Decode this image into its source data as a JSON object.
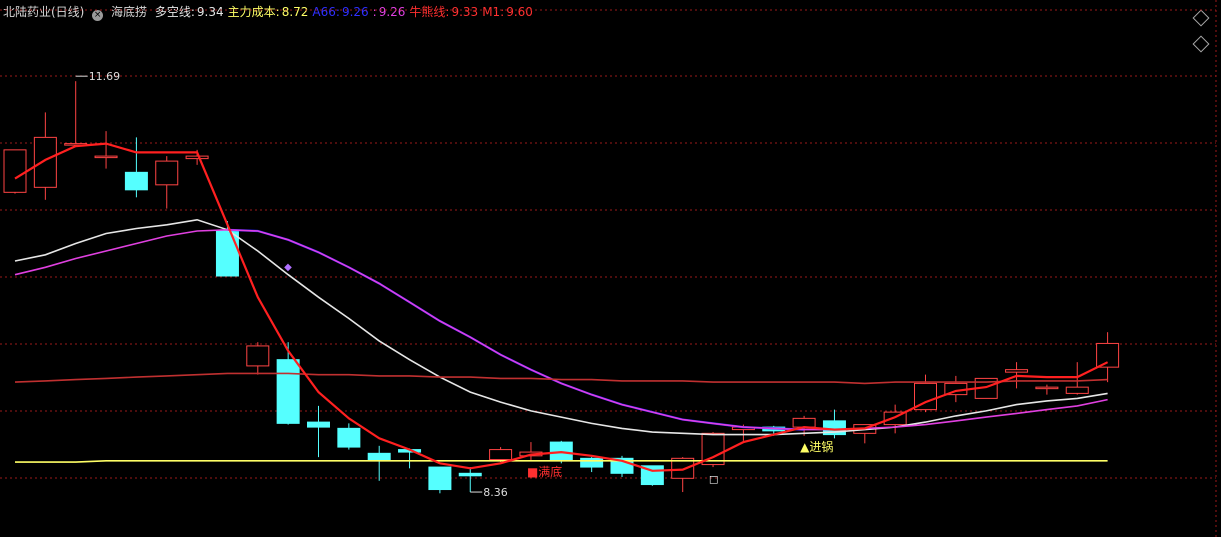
{
  "header": {
    "stock": "北陆药业(日线)",
    "indicator": "海底捞",
    "items": [
      {
        "label": "多空线:",
        "value": "9.34",
        "color": "#e6e6e6"
      },
      {
        "label": "主力成本:",
        "value": "8.72",
        "color": "#ffff66"
      },
      {
        "label": "A66:",
        "value": "9.26",
        "color": "#3030ff"
      },
      {
        "label": ":",
        "value": "9.26",
        "color": "#e040e0"
      },
      {
        "label": "牛熊线:",
        "value": "9.33",
        "color": "#ff3030"
      },
      {
        "label": "M1:",
        "value": "9.60",
        "color": "#ff3030"
      }
    ]
  },
  "chart_data": {
    "type": "candlestick",
    "ylim": [
      8.0,
      12.3
    ],
    "candles": [
      {
        "o": 10.76,
        "h": 11.1,
        "l": 10.75,
        "c": 11.1
      },
      {
        "o": 10.8,
        "h": 11.4,
        "l": 10.7,
        "c": 11.2
      },
      {
        "o": 11.15,
        "h": 11.65,
        "l": 11.14,
        "c": 11.15
      },
      {
        "o": 11.05,
        "h": 11.25,
        "l": 10.95,
        "c": 11.05
      },
      {
        "o": 10.92,
        "h": 11.2,
        "l": 10.72,
        "c": 10.78
      },
      {
        "o": 10.82,
        "h": 11.05,
        "l": 10.63,
        "c": 11.01
      },
      {
        "o": 11.03,
        "h": 11.1,
        "l": 10.98,
        "c": 11.05
      },
      {
        "o": 10.45,
        "h": 10.53,
        "l": 10.09,
        "c": 10.09
      },
      {
        "o": 9.37,
        "h": 9.56,
        "l": 9.3,
        "c": 9.53
      },
      {
        "o": 9.42,
        "h": 9.56,
        "l": 8.9,
        "c": 8.91
      },
      {
        "o": 8.92,
        "h": 9.05,
        "l": 8.64,
        "c": 8.88
      },
      {
        "o": 8.87,
        "h": 8.91,
        "l": 8.7,
        "c": 8.72
      },
      {
        "o": 8.67,
        "h": 8.73,
        "l": 8.45,
        "c": 8.62
      },
      {
        "o": 8.7,
        "h": 8.71,
        "l": 8.55,
        "c": 8.68
      },
      {
        "o": 8.56,
        "h": 8.56,
        "l": 8.35,
        "c": 8.38
      },
      {
        "o": 8.51,
        "h": 8.56,
        "l": 8.36,
        "c": 8.49
      },
      {
        "o": 8.62,
        "h": 8.72,
        "l": 8.6,
        "c": 8.7
      },
      {
        "o": 8.65,
        "h": 8.76,
        "l": 8.61,
        "c": 8.68
      },
      {
        "o": 8.76,
        "h": 8.77,
        "l": 8.59,
        "c": 8.61
      },
      {
        "o": 8.63,
        "h": 8.64,
        "l": 8.52,
        "c": 8.56
      },
      {
        "o": 8.63,
        "h": 8.65,
        "l": 8.48,
        "c": 8.51
      },
      {
        "o": 8.57,
        "h": 8.57,
        "l": 8.41,
        "c": 8.42
      },
      {
        "o": 8.47,
        "h": 8.64,
        "l": 8.36,
        "c": 8.63
      },
      {
        "o": 8.58,
        "h": 8.84,
        "l": 8.56,
        "c": 8.83
      },
      {
        "o": 8.86,
        "h": 8.9,
        "l": 8.77,
        "c": 8.88
      },
      {
        "o": 8.88,
        "h": 8.89,
        "l": 8.81,
        "c": 8.85
      },
      {
        "o": 8.88,
        "h": 8.97,
        "l": 8.81,
        "c": 8.95
      },
      {
        "o": 8.93,
        "h": 9.02,
        "l": 8.79,
        "c": 8.82
      },
      {
        "o": 8.83,
        "h": 8.89,
        "l": 8.75,
        "c": 8.9
      },
      {
        "o": 8.9,
        "h": 9.06,
        "l": 8.83,
        "c": 9.0
      },
      {
        "o": 9.02,
        "h": 9.3,
        "l": 9.0,
        "c": 9.23
      },
      {
        "o": 9.14,
        "h": 9.29,
        "l": 9.08,
        "c": 9.23
      },
      {
        "o": 9.11,
        "h": 9.26,
        "l": 9.12,
        "c": 9.27
      },
      {
        "o": 9.32,
        "h": 9.4,
        "l": 9.19,
        "c": 9.34
      },
      {
        "o": 9.19,
        "h": 9.22,
        "l": 9.14,
        "c": 9.2
      },
      {
        "o": 9.15,
        "h": 9.4,
        "l": 9.14,
        "c": 9.2
      },
      {
        "o": 9.36,
        "h": 9.64,
        "l": 9.24,
        "c": 9.55
      }
    ],
    "series": [
      {
        "name": "多空线",
        "color": "#e6e6e6",
        "values": [
          10.21,
          10.26,
          10.35,
          10.43,
          10.47,
          10.5,
          10.54,
          10.46,
          10.29,
          10.1,
          9.92,
          9.75,
          9.57,
          9.42,
          9.28,
          9.16,
          9.08,
          9.01,
          8.96,
          8.91,
          8.87,
          8.84,
          8.83,
          8.82,
          8.82,
          8.82,
          8.83,
          8.84,
          8.86,
          8.88,
          8.92,
          8.97,
          9.01,
          9.06,
          9.09,
          9.11,
          9.15
        ]
      },
      {
        "name": "主力成本",
        "color": "#ffff66",
        "values": [
          8.6,
          8.6,
          8.6,
          8.61,
          8.61,
          8.61,
          8.61,
          8.61,
          8.61,
          8.61,
          8.61,
          8.61,
          8.61,
          8.61,
          8.61,
          8.61,
          8.61,
          8.61,
          8.61,
          8.61,
          8.61,
          8.61,
          8.61,
          8.61,
          8.61,
          8.61,
          8.61,
          8.61,
          8.61,
          8.61,
          8.61,
          8.61,
          8.61,
          8.61,
          8.61,
          8.61,
          8.61
        ]
      },
      {
        "name": "A66",
        "color": "#2020ff",
        "values": [
          null,
          null,
          null,
          null,
          null,
          null,
          null,
          10.46,
          10.45,
          10.38,
          10.28,
          10.16,
          10.03,
          9.88,
          9.73,
          9.6,
          9.46,
          9.34,
          9.23,
          9.14,
          9.06,
          9.0,
          8.94,
          8.91,
          8.88,
          8.87,
          8.86
        ]
      },
      {
        "name": "",
        "color": "#e040e0",
        "values": [
          10.1,
          10.16,
          10.23,
          10.29,
          10.35,
          10.41,
          10.45,
          10.46,
          10.45,
          10.38,
          10.28,
          10.16,
          10.03,
          9.88,
          9.73,
          9.6,
          9.46,
          9.34,
          9.23,
          9.14,
          9.06,
          9.0,
          8.94,
          8.91,
          8.88,
          8.87,
          8.86,
          8.86,
          8.87,
          8.88,
          8.9,
          8.93,
          8.96,
          8.99,
          9.02,
          9.05,
          9.1
        ]
      },
      {
        "name": "牛熊线",
        "color": "#c03030",
        "values": [
          9.24,
          9.25,
          9.26,
          9.27,
          9.28,
          9.29,
          9.3,
          9.31,
          9.31,
          9.31,
          9.3,
          9.3,
          9.29,
          9.29,
          9.28,
          9.28,
          9.27,
          9.27,
          9.26,
          9.26,
          9.25,
          9.25,
          9.25,
          9.24,
          9.24,
          9.24,
          9.24,
          9.24,
          9.23,
          9.24,
          9.24,
          9.24,
          9.24,
          9.25,
          9.25,
          9.25,
          9.26
        ]
      },
      {
        "name": "M1",
        "color": "#ff2020",
        "values": [
          10.87,
          11.02,
          11.13,
          11.15,
          11.08,
          11.08,
          11.08,
          10.5,
          9.92,
          9.49,
          9.16,
          8.95,
          8.79,
          8.7,
          8.59,
          8.55,
          8.59,
          8.66,
          8.68,
          8.65,
          8.61,
          8.53,
          8.54,
          8.64,
          8.76,
          8.82,
          8.88,
          8.86,
          8.87,
          8.96,
          9.08,
          9.17,
          9.2,
          9.29,
          9.28,
          9.28,
          9.4
        ]
      }
    ],
    "annotations": [
      {
        "text": "11.69",
        "candle": 2,
        "price": 11.69
      },
      {
        "text": "8.36",
        "candle": 15,
        "price": 8.36
      },
      {
        "text": "▲进锅",
        "candle": 26,
        "price": 8.72,
        "color": "#ffff66"
      },
      {
        "text": "■满底",
        "candle": 17,
        "price": 8.52,
        "color": "#ff3030"
      },
      {
        "text": "◆",
        "candle": 9,
        "price": 10.17,
        "color": "#b070ff"
      },
      {
        "text": "□",
        "candle": 23,
        "price": 8.47,
        "color": "#ffffff"
      }
    ],
    "colors": {
      "up": "#ff4444",
      "down": "#55ffff",
      "grid": "#9a1a1a"
    }
  }
}
